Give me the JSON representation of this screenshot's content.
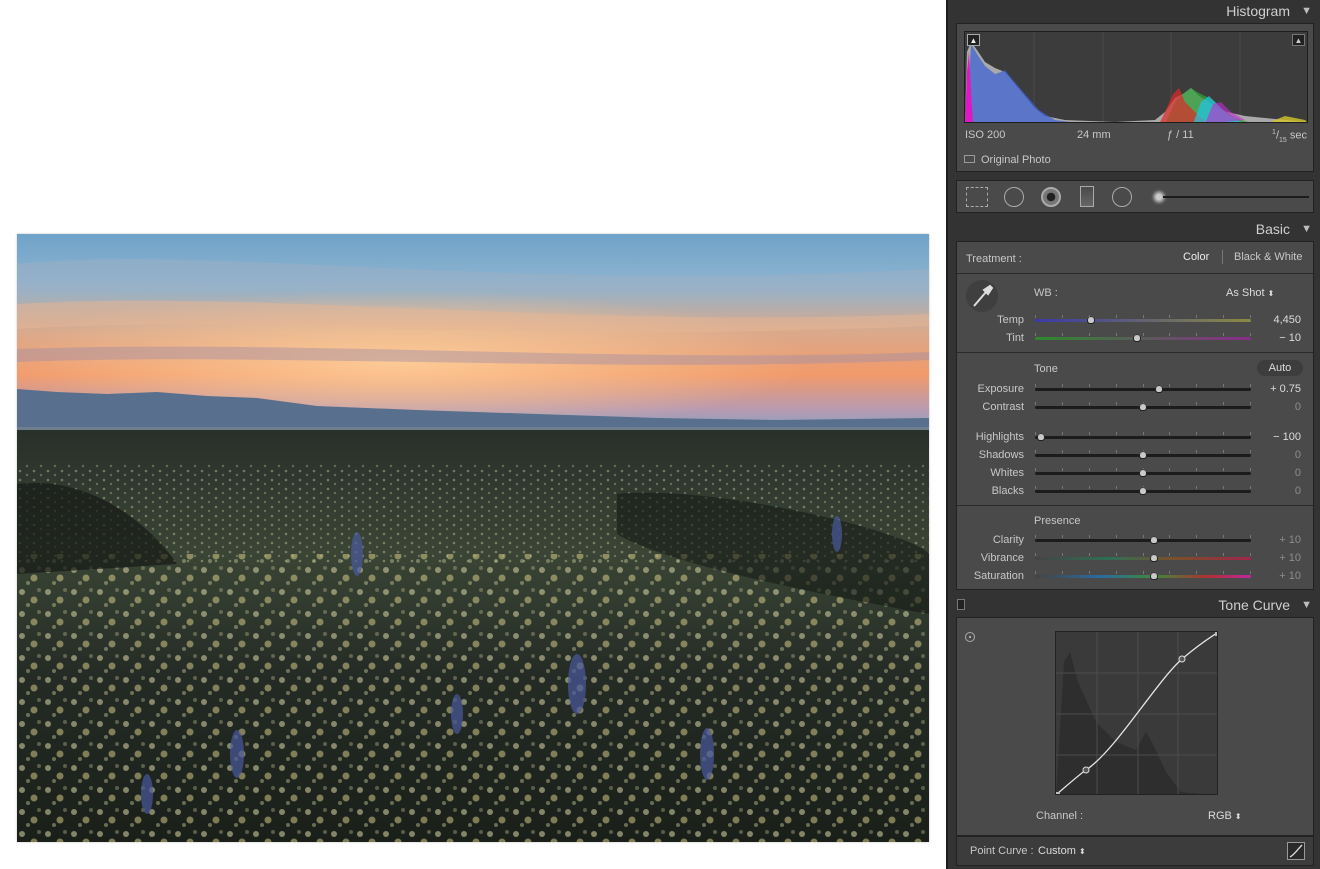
{
  "histogram": {
    "title": "Histogram",
    "iso": "ISO 200",
    "focal": "24 mm",
    "aperture": "ƒ / 11",
    "shutter_num": "1",
    "shutter_den": "15",
    "shutter_unit": "sec",
    "original_photo": "Original Photo"
  },
  "tools": [
    "crop-overlay-icon",
    "spot-removal-icon",
    "red-eye-icon",
    "graduated-filter-icon",
    "radial-filter-icon",
    "adjustment-brush-icon"
  ],
  "basic": {
    "title": "Basic",
    "treatment_label": "Treatment :",
    "color": "Color",
    "bw": "Black & White",
    "wb_label": "WB :",
    "wb_value": "As Shot",
    "temp": {
      "label": "Temp",
      "value": "4,450",
      "pos": 0.26
    },
    "tint": {
      "label": "Tint",
      "value": "− 10",
      "pos": 0.47
    },
    "tone_label": "Tone",
    "auto": "Auto",
    "exposure": {
      "label": "Exposure",
      "value": "+ 0.75",
      "pos": 0.575
    },
    "contrast": {
      "label": "Contrast",
      "value": "0",
      "pos": 0.5
    },
    "highlights": {
      "label": "Highlights",
      "value": "− 100",
      "pos": 0.0
    },
    "shadows": {
      "label": "Shadows",
      "value": "0",
      "pos": 0.5
    },
    "whites": {
      "label": "Whites",
      "value": "0",
      "pos": 0.5
    },
    "blacks": {
      "label": "Blacks",
      "value": "0",
      "pos": 0.5
    },
    "presence_label": "Presence",
    "clarity": {
      "label": "Clarity",
      "value": "+ 10",
      "pos": 0.55
    },
    "vibrance": {
      "label": "Vibrance",
      "value": "+ 10",
      "pos": 0.55
    },
    "saturation": {
      "label": "Saturation",
      "value": "+ 10",
      "pos": 0.55
    }
  },
  "tone_curve": {
    "title": "Tone Curve",
    "channel_label": "Channel :",
    "channel_value": "RGB",
    "point_curve_label": "Point Curve :",
    "point_curve_value": "Custom"
  },
  "colors": {
    "panel_bg": "#333333",
    "section_bg": "#4a4a4a"
  }
}
